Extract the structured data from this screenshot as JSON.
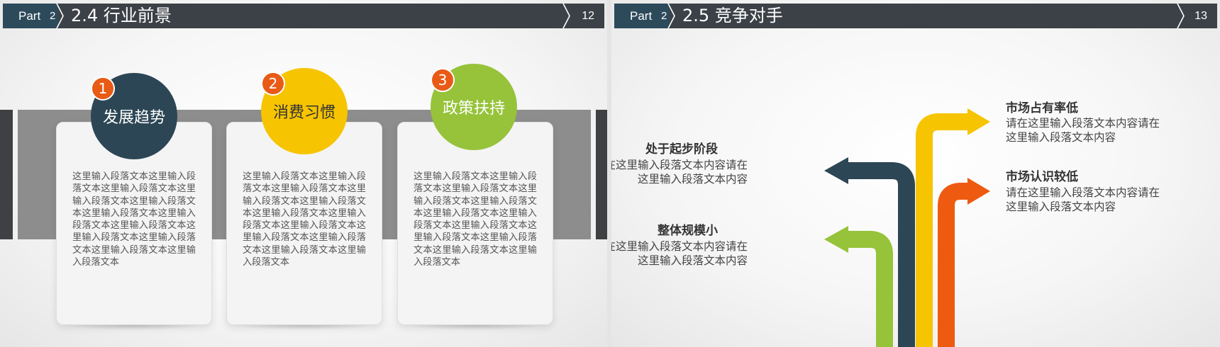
{
  "slides": [
    {
      "header": {
        "part_label": "Part",
        "part_number": "2",
        "title": "2.4 行业前景",
        "page_number": "12"
      },
      "items": [
        {
          "number": "1",
          "title": "发展趋势",
          "color": "#2c4655",
          "text": "这里输入段落文本这里输入段落文本这里输入段落文本这里输入段落文本这里输入段落文本这里输入段落文本这里输入段落文本这里输入段落文本这里输入段落文本这里输入段落文本这里输入段落文本这里输入段落文本"
        },
        {
          "number": "2",
          "title": "消费习惯",
          "color": "#f6c400",
          "text": "这里输入段落文本这里输入段落文本这里输入段落文本这里输入段落文本这里输入段落文本这里输入段落文本这里输入段落文本这里输入段落文本这里输入段落文本这里输入段落文本这里输入段落文本这里输入段落文本"
        },
        {
          "number": "3",
          "title": "政策扶持",
          "color": "#96c33a",
          "text": "这里输入段落文本这里输入段落文本这里输入段落文本这里输入段落文本这里输入段落文本这里输入段落文本这里输入段落文本这里输入段落文本这里输入段落文本这里输入段落文本这里输入段落文本这里输入段落文本"
        }
      ]
    },
    {
      "header": {
        "part_label": "Part",
        "part_number": "2",
        "title": "2.5 竞争对手",
        "page_number": "13"
      },
      "arrows": [
        {
          "label": "处于起步阶段",
          "desc_line1": "请在这里输入段落文本内容请在",
          "desc_line2": "这里输入段落文本内容",
          "color": "#2c4655"
        },
        {
          "label": "整体规模小",
          "desc_line1": "请在这里输入段落文本内容请在",
          "desc_line2": "这里输入段落文本内容",
          "color": "#96c33a"
        },
        {
          "label": "市场占有率低",
          "desc_line1": "请在这里输入段落文本内容请在",
          "desc_line2": "这里输入段落文本内容",
          "color": "#f6c400"
        },
        {
          "label": "市场认识较低",
          "desc_line1": "请在这里输入段落文本内容请在",
          "desc_line2": "这里输入段落文本内容",
          "color": "#ee5a10"
        }
      ]
    }
  ]
}
